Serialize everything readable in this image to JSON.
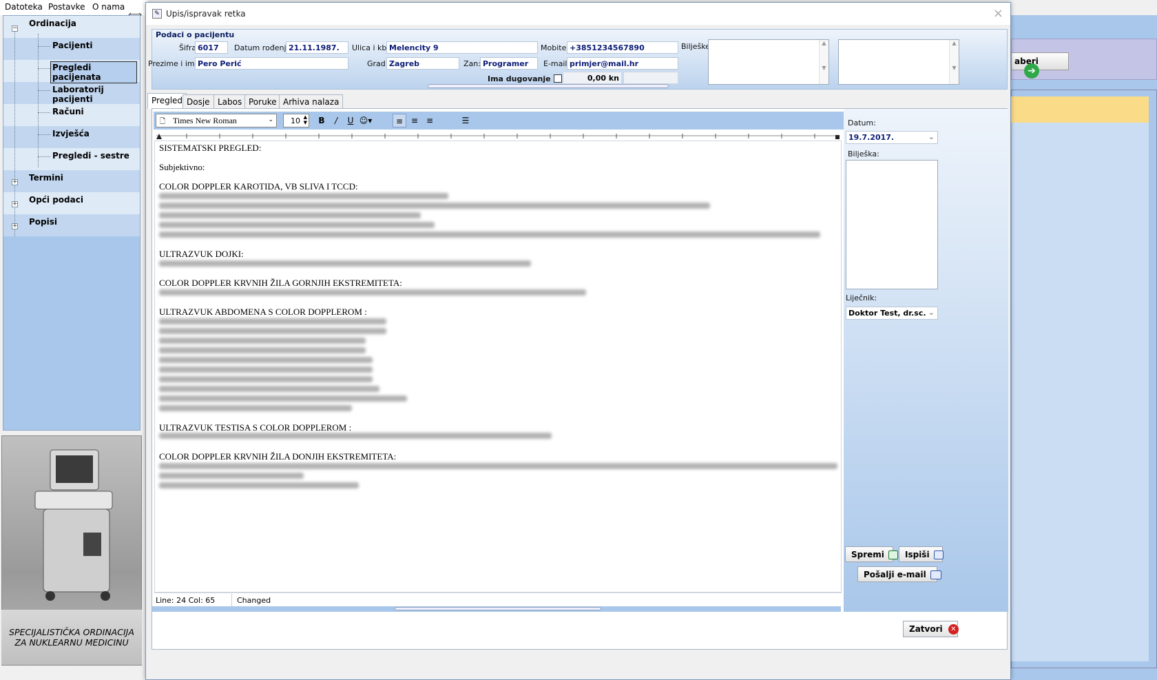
{
  "menu": {
    "file": "Datoteka",
    "settings": "Postavke",
    "about": "O nama"
  },
  "nav": {
    "group_ordinacija": "Ordinacija",
    "items": [
      "Pacijenti",
      "Pregledi pacijenata",
      "Laboratorij pacijenti",
      "Računi",
      "Izvješća",
      "Pregledi - sestre"
    ],
    "group_termini": "Termini",
    "group_opci": "Opći podaci",
    "group_popisi": "Popisi"
  },
  "brand_caption_line1": "SPECIJALISTIČKA ORDINACIJA",
  "brand_caption_line2": "ZA NUKLEARNU MEDICINU",
  "background_app": {
    "button_label": "aberi"
  },
  "dialog": {
    "title": "Upis/ispravak retka",
    "group_title": "Podaci o pacijentu",
    "labels": {
      "sifra": "Šifra:",
      "datum_rodenja": "Datum rođenja:",
      "ulica": "Ulica i kbr.:",
      "mobitel": "Mobitel:",
      "biljeske": "Bilješke:",
      "prezime_ime": "Prezime i ime:",
      "grad": "Grad:",
      "zan": "Zan:",
      "email": "E-mail:",
      "ima_dugovanje": "Ima dugovanje"
    },
    "values": {
      "sifra": "6017",
      "datum_rodenja": "21.11.1987.",
      "ulica": "Melencity 9",
      "mobitel": "+3851234567890",
      "prezime_ime": "Pero Perić",
      "grad": "Zagreb",
      "zan": "Programer",
      "email": "primjer@mail.hr",
      "dug_amount": "0,00 kn"
    },
    "tabs": [
      "Pregled",
      "Dosje",
      "Labos",
      "Poruke",
      "Arhiva nalaza"
    ],
    "editor": {
      "font_name": "Times New Roman",
      "font_size": "10",
      "headings": [
        "SISTEMATSKI PREGLED:",
        "Subjektivno:",
        "COLOR DOPPLER KAROTIDA, VB SLIVA I TCCD:",
        "ULTRAZVUK DOJKI:",
        "COLOR DOPPLER KRVNIH ŽILA GORNJIH EKSTREMITETA:",
        "ULTRAZVUK ABDOMENA S COLOR DOPPLEROM :",
        "ULTRAZVUK TESTISA S COLOR DOPPLEROM :",
        "COLOR DOPPLER KRVNIH ŽILA DONJIH EKSTREMITETA:"
      ],
      "status_line": "Line: 24 Col: 65",
      "status_changed": "Changed"
    },
    "side": {
      "datum_label": "Datum:",
      "datum_value": "19.7.2017.",
      "biljeska_label": "Bilješka:",
      "lijecnik_label": "Liječnik:",
      "lijecnik_value": "Doktor Test, dr.sc.",
      "spremi": "Spremi",
      "ispisi": "Ispiši",
      "posalji": "Pošalji e-mail"
    },
    "zatvori": "Zatvori"
  }
}
